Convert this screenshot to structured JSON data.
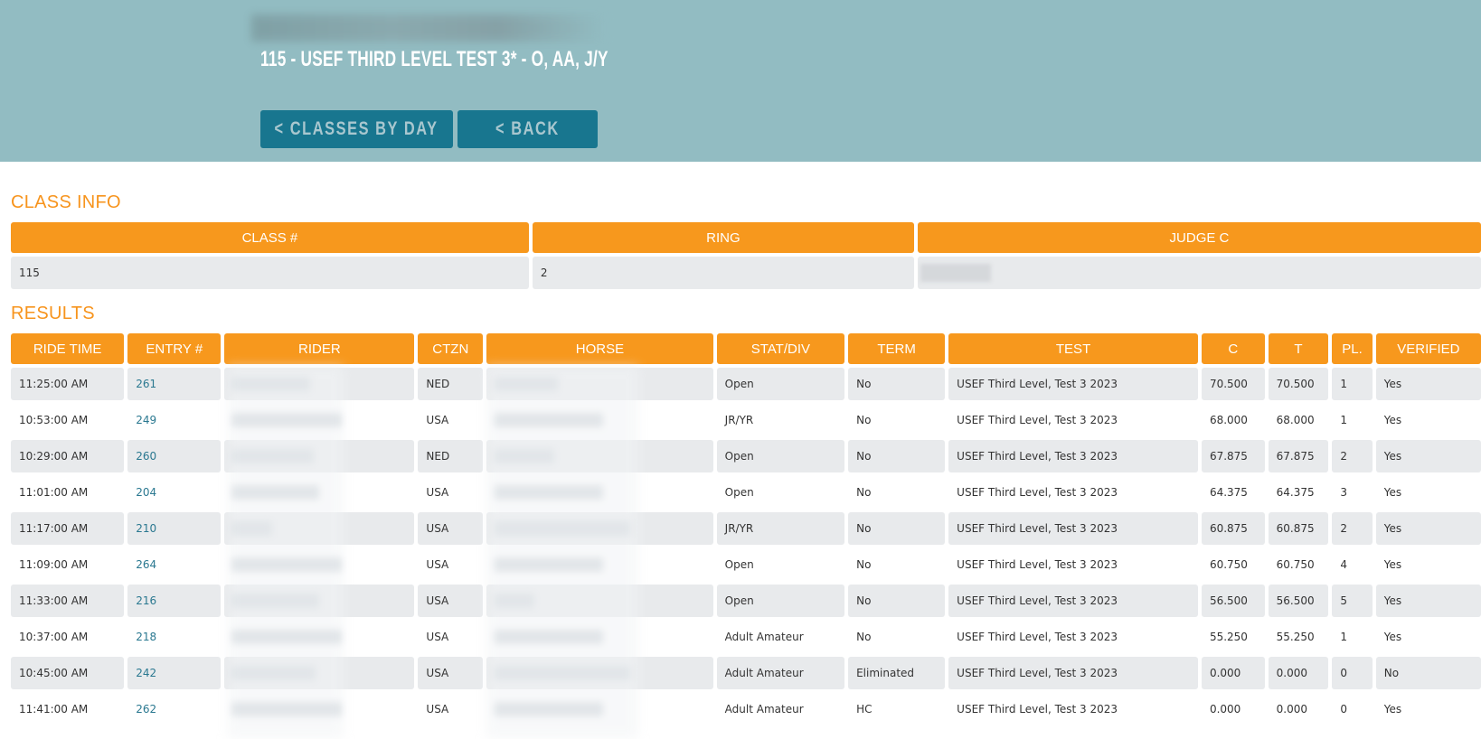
{
  "header": {
    "title": "115 - USEF THIRD LEVEL TEST 3* - O, AA, J/Y",
    "buttons": {
      "classes_by_day": "< CLASSES BY DAY",
      "back": "< BACK"
    }
  },
  "class_info": {
    "heading": "CLASS INFO",
    "columns": [
      "CLASS #",
      "RING",
      "JUDGE C"
    ],
    "values": {
      "class_number": "115",
      "ring": "2"
    }
  },
  "results": {
    "heading": "RESULTS",
    "columns": [
      "RIDE TIME",
      "ENTRY #",
      "RIDER",
      "CTZN",
      "HORSE",
      "STAT/DIV",
      "TERM",
      "TEST",
      "C",
      "T",
      "PL.",
      "VERIFIED"
    ],
    "rows": [
      {
        "ride_time": "11:25:00 AM",
        "entry": "261",
        "ctzn": "NED",
        "stat": "Open",
        "term": "No",
        "test": "USEF Third Level, Test 3 2023",
        "c": "70.500",
        "t": "70.500",
        "pl": "1",
        "verified": "Yes"
      },
      {
        "ride_time": "10:53:00 AM",
        "entry": "249",
        "ctzn": "USA",
        "stat": "JR/YR",
        "term": "No",
        "test": "USEF Third Level, Test 3 2023",
        "c": "68.000",
        "t": "68.000",
        "pl": "1",
        "verified": "Yes"
      },
      {
        "ride_time": "10:29:00 AM",
        "entry": "260",
        "ctzn": "NED",
        "stat": "Open",
        "term": "No",
        "test": "USEF Third Level, Test 3 2023",
        "c": "67.875",
        "t": "67.875",
        "pl": "2",
        "verified": "Yes"
      },
      {
        "ride_time": "11:01:00 AM",
        "entry": "204",
        "ctzn": "USA",
        "stat": "Open",
        "term": "No",
        "test": "USEF Third Level, Test 3 2023",
        "c": "64.375",
        "t": "64.375",
        "pl": "3",
        "verified": "Yes"
      },
      {
        "ride_time": "11:17:00 AM",
        "entry": "210",
        "ctzn": "USA",
        "stat": "JR/YR",
        "term": "No",
        "test": "USEF Third Level, Test 3 2023",
        "c": "60.875",
        "t": "60.875",
        "pl": "2",
        "verified": "Yes"
      },
      {
        "ride_time": "11:09:00 AM",
        "entry": "264",
        "ctzn": "USA",
        "stat": "Open",
        "term": "No",
        "test": "USEF Third Level, Test 3 2023",
        "c": "60.750",
        "t": "60.750",
        "pl": "4",
        "verified": "Yes"
      },
      {
        "ride_time": "11:33:00 AM",
        "entry": "216",
        "ctzn": "USA",
        "stat": "Open",
        "term": "No",
        "test": "USEF Third Level, Test 3 2023",
        "c": "56.500",
        "t": "56.500",
        "pl": "5",
        "verified": "Yes"
      },
      {
        "ride_time": "10:37:00 AM",
        "entry": "218",
        "ctzn": "USA",
        "stat": "Adult Amateur",
        "term": "No",
        "test": "USEF Third Level, Test 3 2023",
        "c": "55.250",
        "t": "55.250",
        "pl": "1",
        "verified": "Yes"
      },
      {
        "ride_time": "10:45:00 AM",
        "entry": "242",
        "ctzn": "USA",
        "stat": "Adult Amateur",
        "term": "Eliminated",
        "test": "USEF Third Level, Test 3 2023",
        "c": "0.000",
        "t": "0.000",
        "pl": "0",
        "verified": "No"
      },
      {
        "ride_time": "11:41:00 AM",
        "entry": "262",
        "ctzn": "USA",
        "stat": "Adult Amateur",
        "term": "HC",
        "test": "USEF Third Level, Test 3 2023",
        "c": "0.000",
        "t": "0.000",
        "pl": "0",
        "verified": "Yes"
      }
    ]
  },
  "colors": {
    "hero_bg": "#92bcc2",
    "button_bg": "#18768f",
    "accent_orange": "#f7981d",
    "row_alt": "#e8eaec",
    "link": "#2a7890"
  }
}
